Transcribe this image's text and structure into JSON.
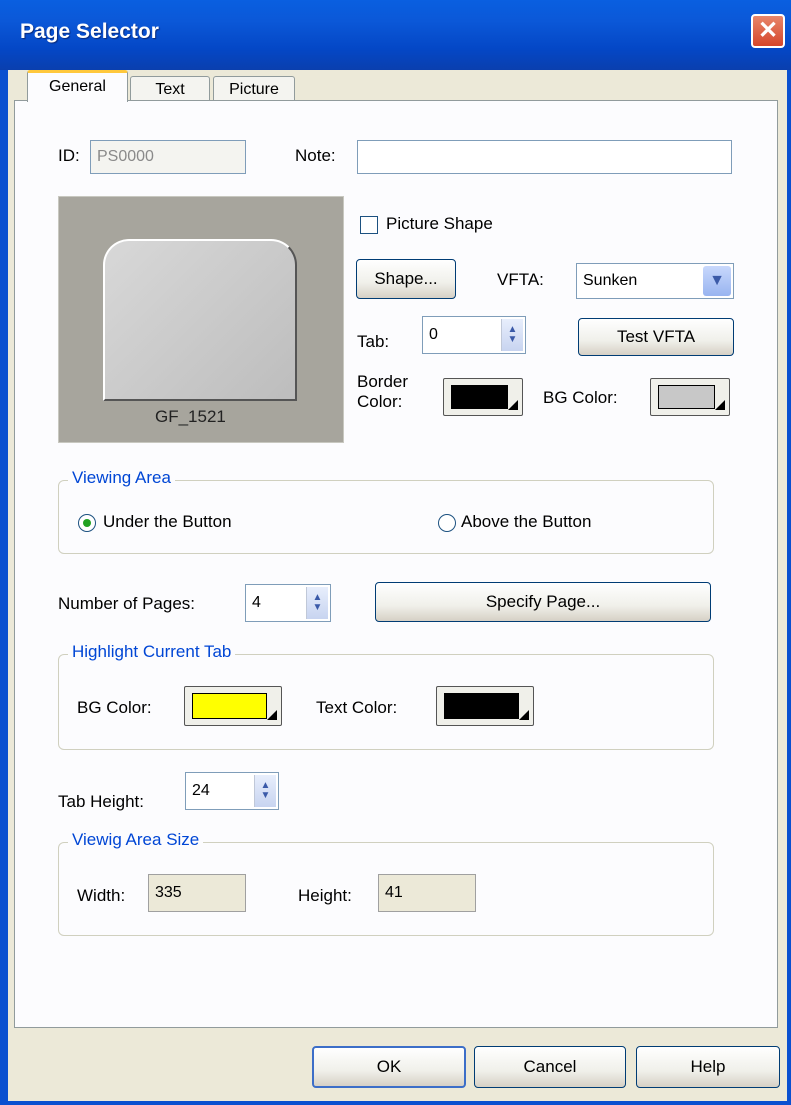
{
  "window": {
    "title": "Page Selector",
    "close_glyph": "✕"
  },
  "tabs": [
    {
      "label": "General",
      "active": true
    },
    {
      "label": "Text",
      "active": false
    },
    {
      "label": "Picture",
      "active": false
    }
  ],
  "general": {
    "id_label": "ID:",
    "id_value": "PS0000",
    "note_label": "Note:",
    "note_value": "",
    "preview_caption": "GF_1521",
    "picture_shape_label": "Picture Shape",
    "picture_shape_checked": false,
    "shape_button": "Shape...",
    "vfta_label": "VFTA:",
    "vfta_value": "Sunken",
    "tab_label": "Tab:",
    "tab_value": "0",
    "test_vfta_button": "Test VFTA",
    "border_color_label_line1": "Border",
    "border_color_label_line2": "Color:",
    "border_color": "#000000",
    "bg_color_label": "BG Color:",
    "bg_color": "#c8c8c8"
  },
  "viewing_area": {
    "title": "Viewing Area",
    "option_under": "Under the Button",
    "option_above": "Above the Button",
    "selected": "under"
  },
  "pages": {
    "label": "Number of Pages:",
    "value": "4",
    "specify_button": "Specify Page..."
  },
  "highlight": {
    "title": "Highlight Current Tab",
    "bg_label": "BG Color:",
    "bg_color": "#ffff00",
    "text_label": "Text Color:",
    "text_color": "#000000"
  },
  "tab_height": {
    "label": "Tab Height:",
    "value": "24"
  },
  "area_size": {
    "title": "Viewig Area Size",
    "width_label": "Width:",
    "width_value": "335",
    "height_label": "Height:",
    "height_value": "41"
  },
  "footer": {
    "ok": "OK",
    "cancel": "Cancel",
    "help": "Help"
  }
}
